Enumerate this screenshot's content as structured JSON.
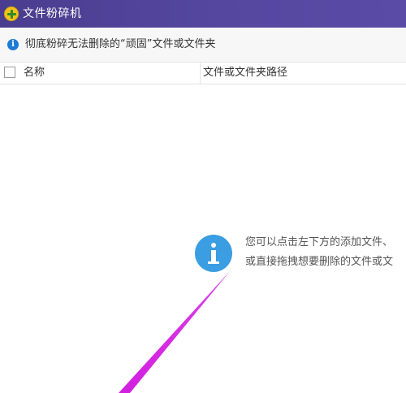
{
  "window": {
    "title": "文件粉碎机",
    "app_icon": "shredder-app-icon"
  },
  "infobar": {
    "icon": "info-icon",
    "text": "彻底粉碎无法删除的“顽固”文件或文件夹"
  },
  "table": {
    "columns": [
      "名称",
      "文件或文件夹路径"
    ],
    "select_all_checked": false,
    "rows": []
  },
  "empty_state": {
    "icon": "info-icon",
    "line1": "您可以点击左下方的添加文件、",
    "line2": "或直接拖拽想要删除的文件或文"
  },
  "annotation": {
    "color": "#d21fe0"
  }
}
